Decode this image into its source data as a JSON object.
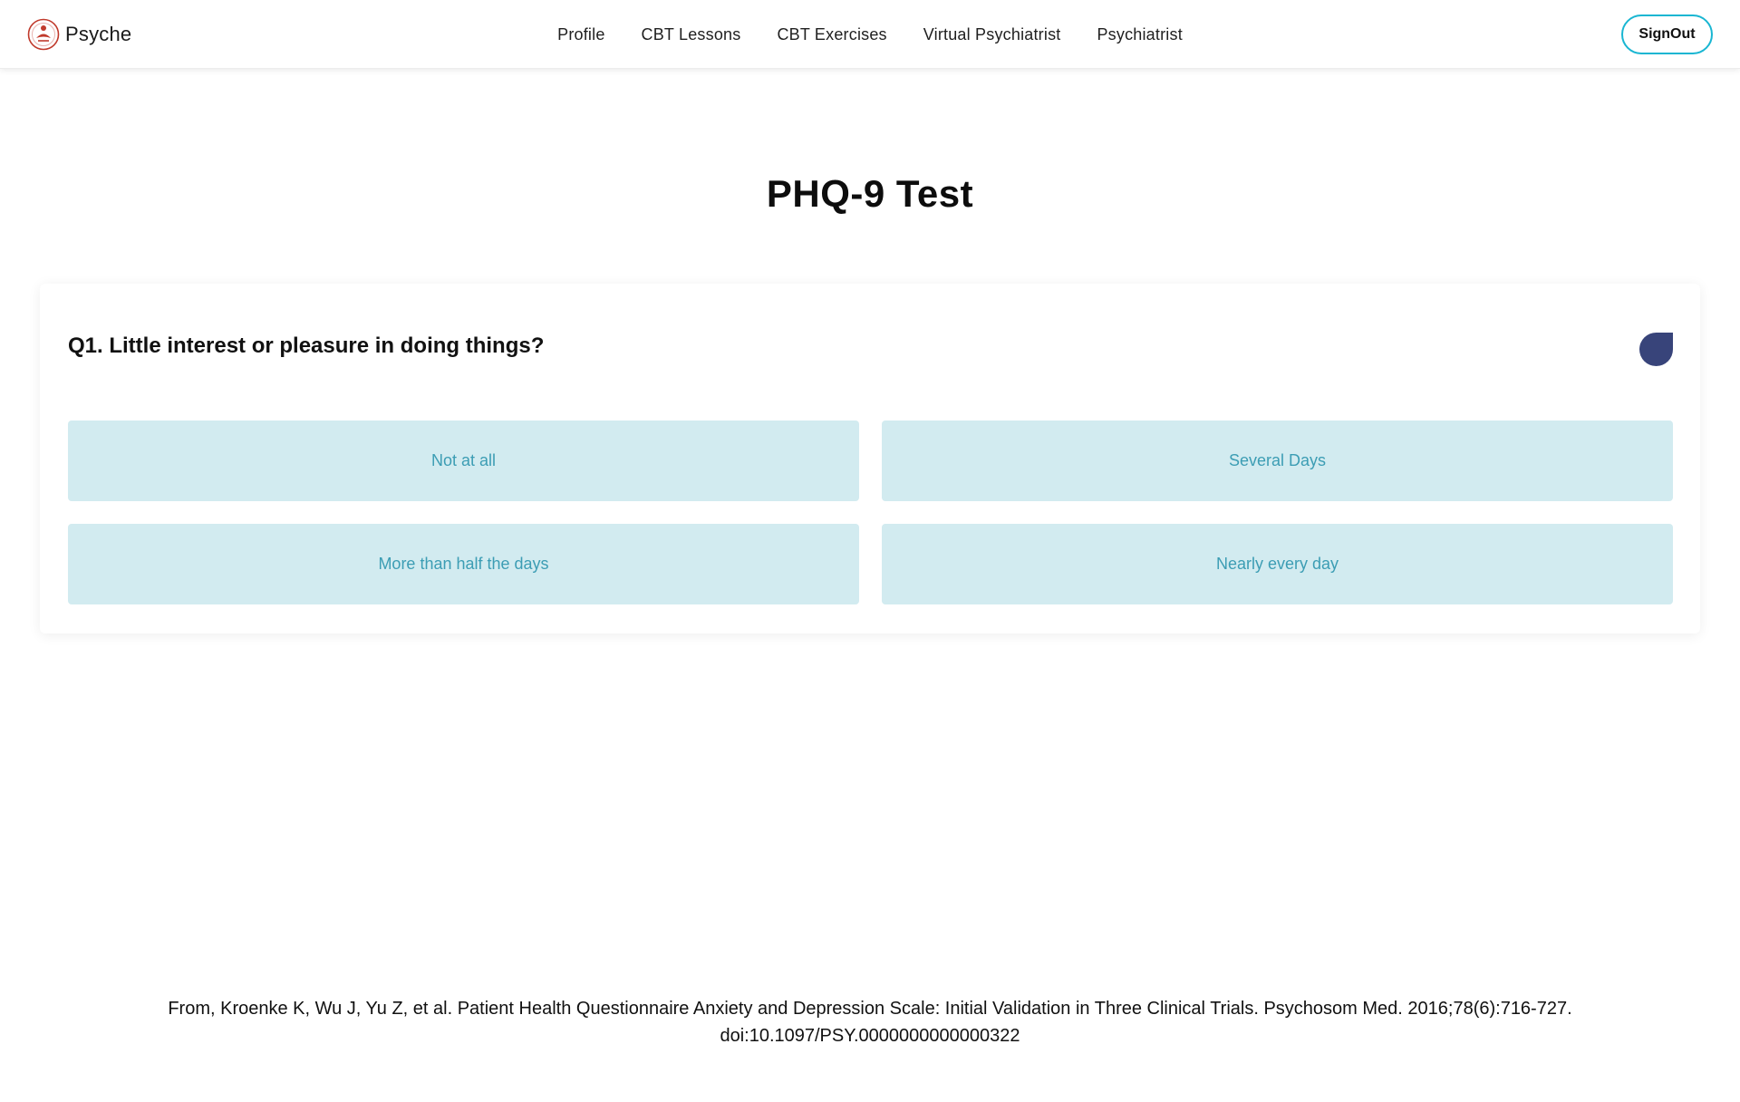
{
  "brand": {
    "name": "Psyche"
  },
  "nav": {
    "links": [
      {
        "label": "Profile"
      },
      {
        "label": "CBT Lessons"
      },
      {
        "label": "CBT Exercises"
      },
      {
        "label": "Virtual Psychiatrist"
      },
      {
        "label": "Psychiatrist"
      }
    ],
    "signout_label": "SignOut"
  },
  "page": {
    "title": "PHQ-9 Test"
  },
  "question": {
    "text": "Q1. Little interest or pleasure in doing things?",
    "options": [
      {
        "label": "Not at all"
      },
      {
        "label": "Several Days"
      },
      {
        "label": "More than half the days"
      },
      {
        "label": "Nearly every day"
      }
    ]
  },
  "footer": {
    "citation_line1": "From,   Kroenke K, Wu J, Yu Z, et al. Patient Health Questionnaire Anxiety and Depression Scale: Initial Validation in Three Clinical Trials. Psychosom Med. 2016;78(6):716-727.",
    "citation_line2": "doi:10.1097/PSY.0000000000000322"
  },
  "colors": {
    "accent": "#19b6d2",
    "option_bg": "#d2ebf0",
    "option_text": "#3c9db4",
    "indicator": "#38447a"
  }
}
